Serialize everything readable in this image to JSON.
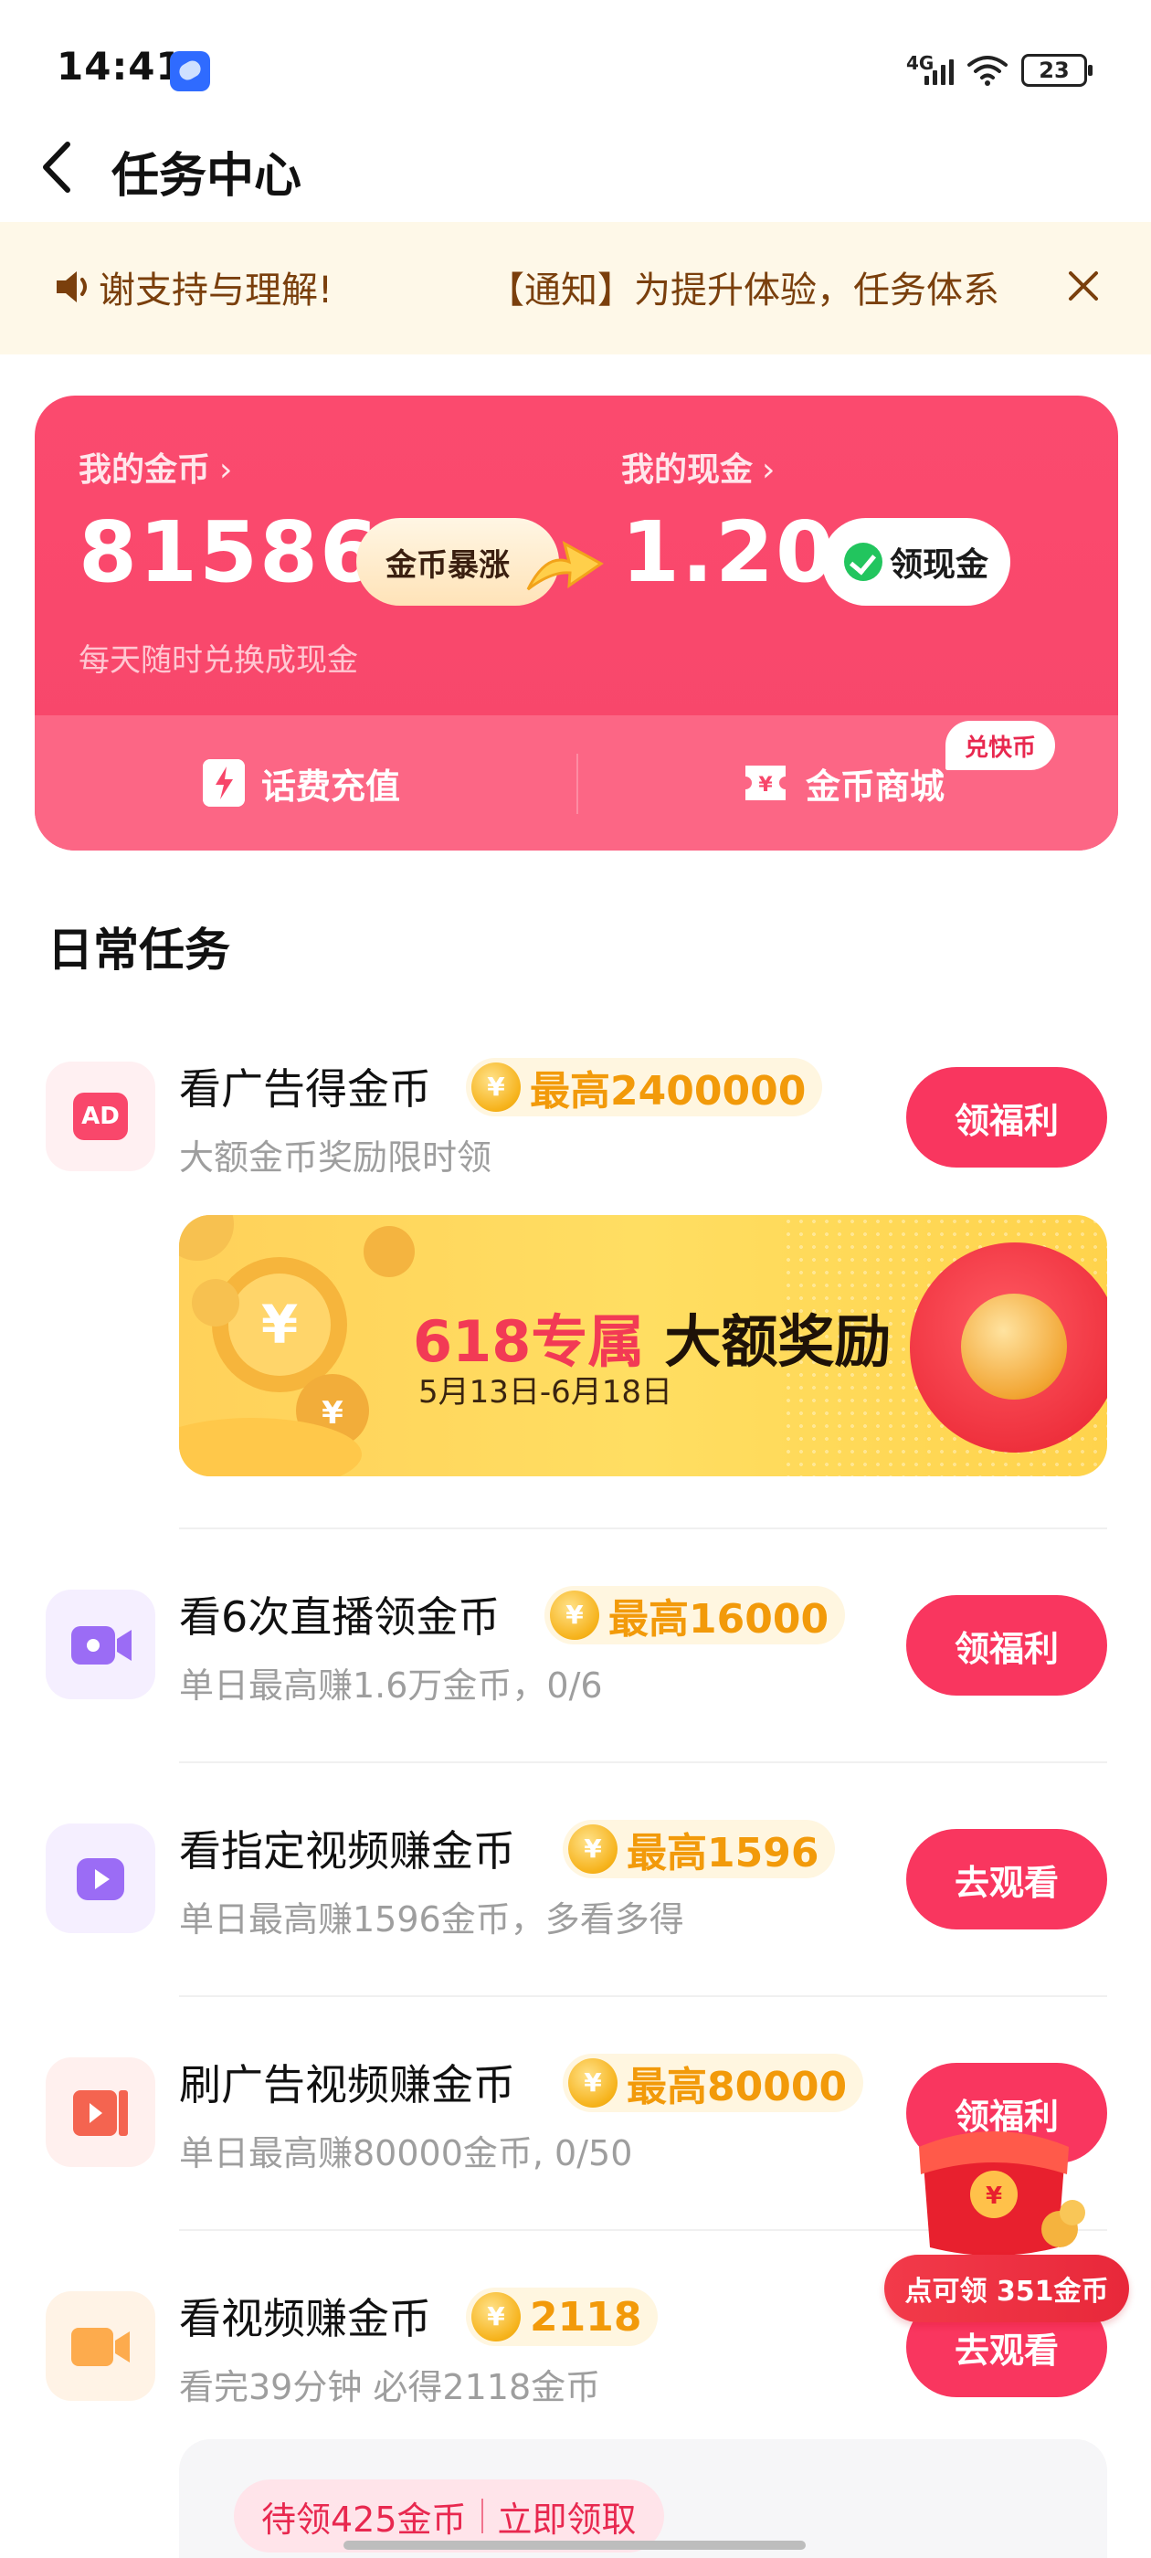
{
  "status_bar": {
    "time": "14:41",
    "network": "4G",
    "battery": "23"
  },
  "header": {
    "title": "任务中心"
  },
  "notice": {
    "text_part1": "谢支持与理解!",
    "text_part2": "【通知】为提升体验，任务体系"
  },
  "coin_card": {
    "coins_label": "我的金币",
    "coins_value": "81586",
    "surge_label": "金币暴涨",
    "cash_label": "我的现金",
    "cash_value": "1.20",
    "claim_cash_label": "领现金",
    "sub_text": "每天随时兑换成现金",
    "phone_recharge_label": "话费充值",
    "mall_label": "金币商城",
    "mall_badge": "兑快币",
    "accent": "#f7466a"
  },
  "daily": {
    "title": "日常任务",
    "tasks": [
      {
        "title": "看广告得金币",
        "reward": "最高2400000",
        "sub": "大额金币奖励限时领",
        "button": "领福利",
        "icon": "ad-icon"
      },
      {
        "title": "看6次直播领金币",
        "reward": "最高16000",
        "sub": "单日最高赚1.6万金币，0/6",
        "button": "领福利",
        "icon": "live-camera-icon"
      },
      {
        "title": "看指定视频赚金币",
        "reward": "最高1596",
        "sub": "单日最高赚1596金币，多看多得",
        "button": "去观看",
        "icon": "play-icon"
      },
      {
        "title": "刷广告视频赚金币",
        "reward": "最高80000",
        "sub": "单日最高赚80000金币, 0/50",
        "button": "领福利",
        "icon": "video-ad-icon"
      },
      {
        "title": "看视频赚金币",
        "reward": "2118",
        "sub": "看完39分钟 必得2118金币",
        "button": "去观看",
        "icon": "video-camera-icon"
      }
    ]
  },
  "banner": {
    "title_red": "618专属",
    "title_black": "大额奖励",
    "date": "5月13日-6月18日"
  },
  "redpack": {
    "label": "点可领 351金币"
  },
  "bottom": {
    "claim_left": "待领425金币",
    "claim_right": "立即领取"
  }
}
